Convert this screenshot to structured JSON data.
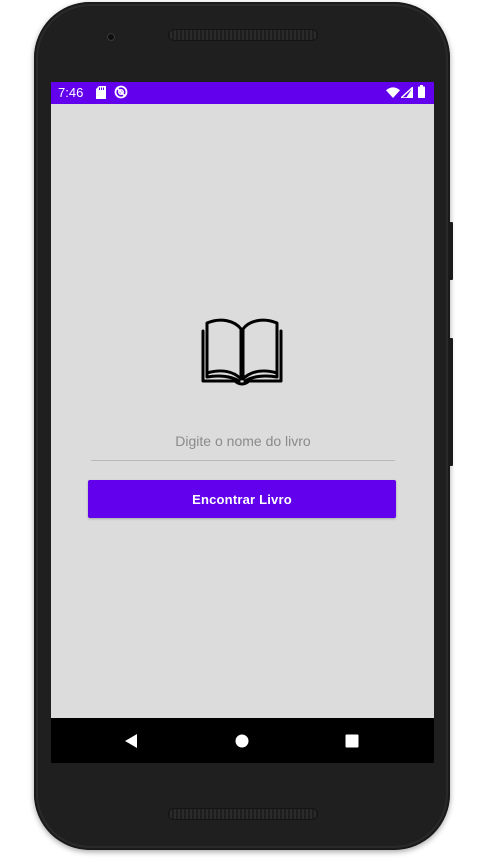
{
  "status_bar": {
    "time": "7:46",
    "background_color": "#6200ee",
    "left_icons": [
      "sd-card-icon",
      "no-sync-icon"
    ],
    "right_icons": [
      "wifi-icon",
      "signal-icon",
      "battery-icon"
    ]
  },
  "main": {
    "icon": "open-book-icon",
    "book_name_input": {
      "placeholder": "Digite o nome do livro",
      "value": ""
    },
    "find_button_label": "Encontrar Livro",
    "accent_color": "#6200ee",
    "background_color": "#dcdcdc"
  },
  "nav_bar": {
    "buttons": [
      "back-icon",
      "home-icon",
      "recents-icon"
    ]
  }
}
